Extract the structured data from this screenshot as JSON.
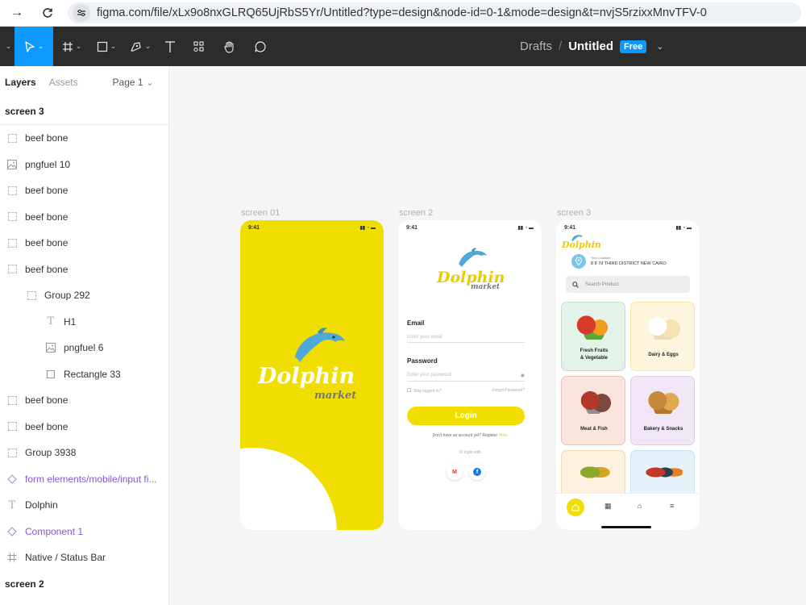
{
  "browser": {
    "url": "figma.com/file/xLx9o8nxGLRQ65UjRbS5Yr/Untitled?type=design&node-id=0-1&mode=design&t=nvjS5rzixxMnvTFV-0"
  },
  "toolbar": {
    "breadcrumb_root": "Drafts",
    "breadcrumb_sep": "/",
    "file_name": "Untitled",
    "plan_badge": "Free"
  },
  "panel": {
    "tab_layers": "Layers",
    "tab_assets": "Assets",
    "page_selector": "Page 1",
    "page_chevron": "⌄",
    "current_frame": "screen 3",
    "layers": [
      {
        "label": "beef bone",
        "icon": "group-icon"
      },
      {
        "label": "pngfuel 10",
        "icon": "image-icon"
      },
      {
        "label": "beef bone",
        "icon": "group-icon"
      },
      {
        "label": "beef bone",
        "icon": "group-icon"
      },
      {
        "label": "beef bone",
        "icon": "group-icon"
      },
      {
        "label": "beef bone",
        "icon": "group-icon"
      },
      {
        "label": "Group 292",
        "icon": "group-icon"
      },
      {
        "label": "H1",
        "icon": "text-icon"
      },
      {
        "label": "pngfuel 6",
        "icon": "image-icon"
      },
      {
        "label": "Rectangle 33",
        "icon": "rectangle-icon"
      },
      {
        "label": "beef bone",
        "icon": "group-icon"
      },
      {
        "label": "beef bone",
        "icon": "group-icon"
      },
      {
        "label": "Group 3938",
        "icon": "group-icon"
      },
      {
        "label": "form elements/mobile/input fi...",
        "icon": "component-instance-icon"
      },
      {
        "label": "Dolphin",
        "icon": "text-icon"
      },
      {
        "label": "Component 1",
        "icon": "component-instance-icon"
      },
      {
        "label": "Native / Status Bar",
        "icon": "frame-icon"
      }
    ],
    "next_frame": "screen 2"
  },
  "canvas": {
    "frame_labels": [
      "screen 01",
      "screen 2",
      "screen 3"
    ],
    "status_time": "9:41",
    "screen1": {
      "brand": "Dolphin",
      "subtitle": "market"
    },
    "screen2": {
      "brand": "Dolphin",
      "subtitle": "market",
      "email_label": "Email",
      "email_placeholder": "Enter your email",
      "password_label": "Password",
      "password_placeholder": "Enter your password",
      "remember": "Stay logged in?",
      "forgot": "Forgot Password?",
      "login": "Login",
      "register_prompt": "Don't have an account yet? Register",
      "register_link": "Here",
      "or_login": "Or login with",
      "google": "M",
      "facebook": "f"
    },
    "screen3": {
      "brand": "Dolphin",
      "location_label": "Your Location",
      "location_value": "8 8 7d THIRD DISTRICT NEW CAIRO",
      "search_placeholder": "Search Product",
      "categories": [
        {
          "label1": "Fresh Fruits",
          "label2": "& Vegetable",
          "bg": "#e3f3ea"
        },
        {
          "label1": "Dairy & Eggs",
          "label2": "",
          "bg": "#fdf6dc"
        },
        {
          "label1": "Meat & Fish",
          "label2": "",
          "bg": "#fbe3de"
        },
        {
          "label1": "Bakery & Snacks",
          "label2": "",
          "bg": "#f1e6f6"
        },
        {
          "label1": "",
          "label2": "",
          "bg": "#fdf0df"
        },
        {
          "label1": "",
          "label2": "",
          "bg": "#e6f2fa"
        }
      ]
    }
  },
  "colors": {
    "accent": "#0d99ff",
    "brand_yellow": "#f0de00",
    "component_purple": "#8a52e0"
  }
}
